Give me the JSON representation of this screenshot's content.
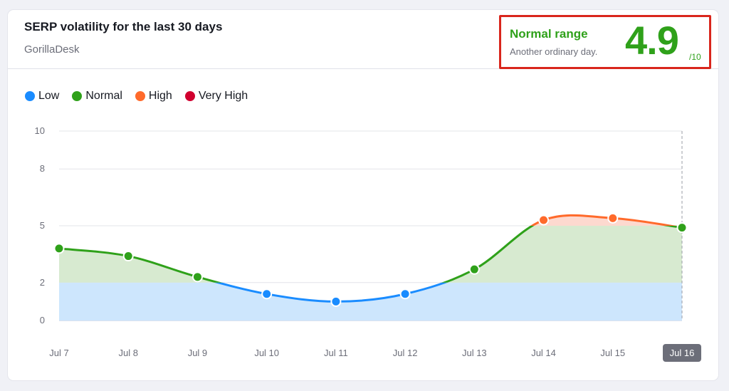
{
  "header": {
    "title": "SERP volatility for the last 30 days",
    "subtitle": "GorillaDesk"
  },
  "score": {
    "range_label": "Normal range",
    "description": "Another ordinary day.",
    "value": "4.9",
    "max": "/10",
    "color": "#2fa11a",
    "highlight_border": "#d9261c"
  },
  "legend": [
    {
      "label": "Low",
      "color": "#1a8cff"
    },
    {
      "label": "Normal",
      "color": "#2fa11a"
    },
    {
      "label": "High",
      "color": "#ff6a2b"
    },
    {
      "label": "Very High",
      "color": "#d1002f"
    }
  ],
  "chart_data": {
    "type": "area",
    "title": "SERP volatility for the last 30 days",
    "xlabel": "",
    "ylabel": "",
    "categories": [
      "Jul 7",
      "Jul 8",
      "Jul 9",
      "Jul 10",
      "Jul 11",
      "Jul 12",
      "Jul 13",
      "Jul 14",
      "Jul 15",
      "Jul 16"
    ],
    "values": [
      3.8,
      3.4,
      2.3,
      1.4,
      1.0,
      1.4,
      2.7,
      5.3,
      5.4,
      4.9
    ],
    "ylim": [
      0,
      10
    ],
    "yticks": [
      0,
      2,
      5,
      8,
      10
    ],
    "bands": [
      {
        "name": "Low",
        "from": 0,
        "to": 2,
        "color": "#1a8cff",
        "fill": "#cde6fd"
      },
      {
        "name": "Normal",
        "from": 2,
        "to": 5,
        "color": "#2fa11a",
        "fill": "#d7ead0"
      },
      {
        "name": "High",
        "from": 5,
        "to": 8,
        "color": "#ff6a2b",
        "fill": "#fdd9cf"
      },
      {
        "name": "Very High",
        "from": 8,
        "to": 10,
        "color": "#d1002f",
        "fill": "#f8cdd6"
      }
    ],
    "selected_category": "Jul 16",
    "grid": true,
    "legend_position": "top-left"
  }
}
